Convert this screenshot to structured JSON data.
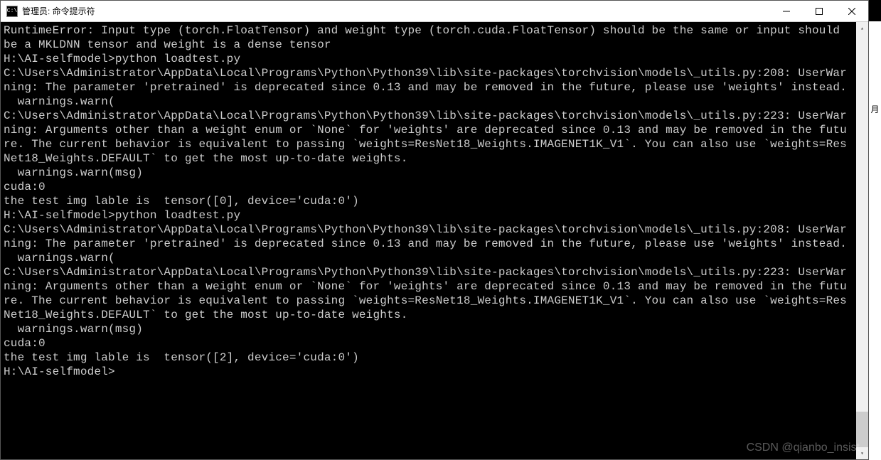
{
  "window": {
    "title": "管理员: 命令提示符",
    "icon_label": "C:\\"
  },
  "terminal": {
    "lines": [
      "RuntimeError: Input type (torch.FloatTensor) and weight type (torch.cuda.FloatTensor) should be the same or input should be a MKLDNN tensor and weight is a dense tensor",
      "",
      "H:\\AI-selfmodel>python loadtest.py",
      "C:\\Users\\Administrator\\AppData\\Local\\Programs\\Python\\Python39\\lib\\site-packages\\torchvision\\models\\_utils.py:208: UserWarning: The parameter 'pretrained' is deprecated since 0.13 and may be removed in the future, please use 'weights' instead.",
      "  warnings.warn(",
      "C:\\Users\\Administrator\\AppData\\Local\\Programs\\Python\\Python39\\lib\\site-packages\\torchvision\\models\\_utils.py:223: UserWarning: Arguments other than a weight enum or `None` for 'weights' are deprecated since 0.13 and may be removed in the future. The current behavior is equivalent to passing `weights=ResNet18_Weights.IMAGENET1K_V1`. You can also use `weights=ResNet18_Weights.DEFAULT` to get the most up-to-date weights.",
      "  warnings.warn(msg)",
      "cuda:0",
      "the test img lable is  tensor([0], device='cuda:0')",
      "",
      "H:\\AI-selfmodel>python loadtest.py",
      "C:\\Users\\Administrator\\AppData\\Local\\Programs\\Python\\Python39\\lib\\site-packages\\torchvision\\models\\_utils.py:208: UserWarning: The parameter 'pretrained' is deprecated since 0.13 and may be removed in the future, please use 'weights' instead.",
      "  warnings.warn(",
      "C:\\Users\\Administrator\\AppData\\Local\\Programs\\Python\\Python39\\lib\\site-packages\\torchvision\\models\\_utils.py:223: UserWarning: Arguments other than a weight enum or `None` for 'weights' are deprecated since 0.13 and may be removed in the future. The current behavior is equivalent to passing `weights=ResNet18_Weights.IMAGENET1K_V1`. You can also use `weights=ResNet18_Weights.DEFAULT` to get the most up-to-date weights.",
      "  warnings.warn(msg)",
      "cuda:0",
      "the test img lable is  tensor([2], device='cuda:0')",
      "",
      "H:\\AI-selfmodel>"
    ]
  },
  "watermark": "CSDN @qianbo_insist",
  "right_edge_char": "月"
}
